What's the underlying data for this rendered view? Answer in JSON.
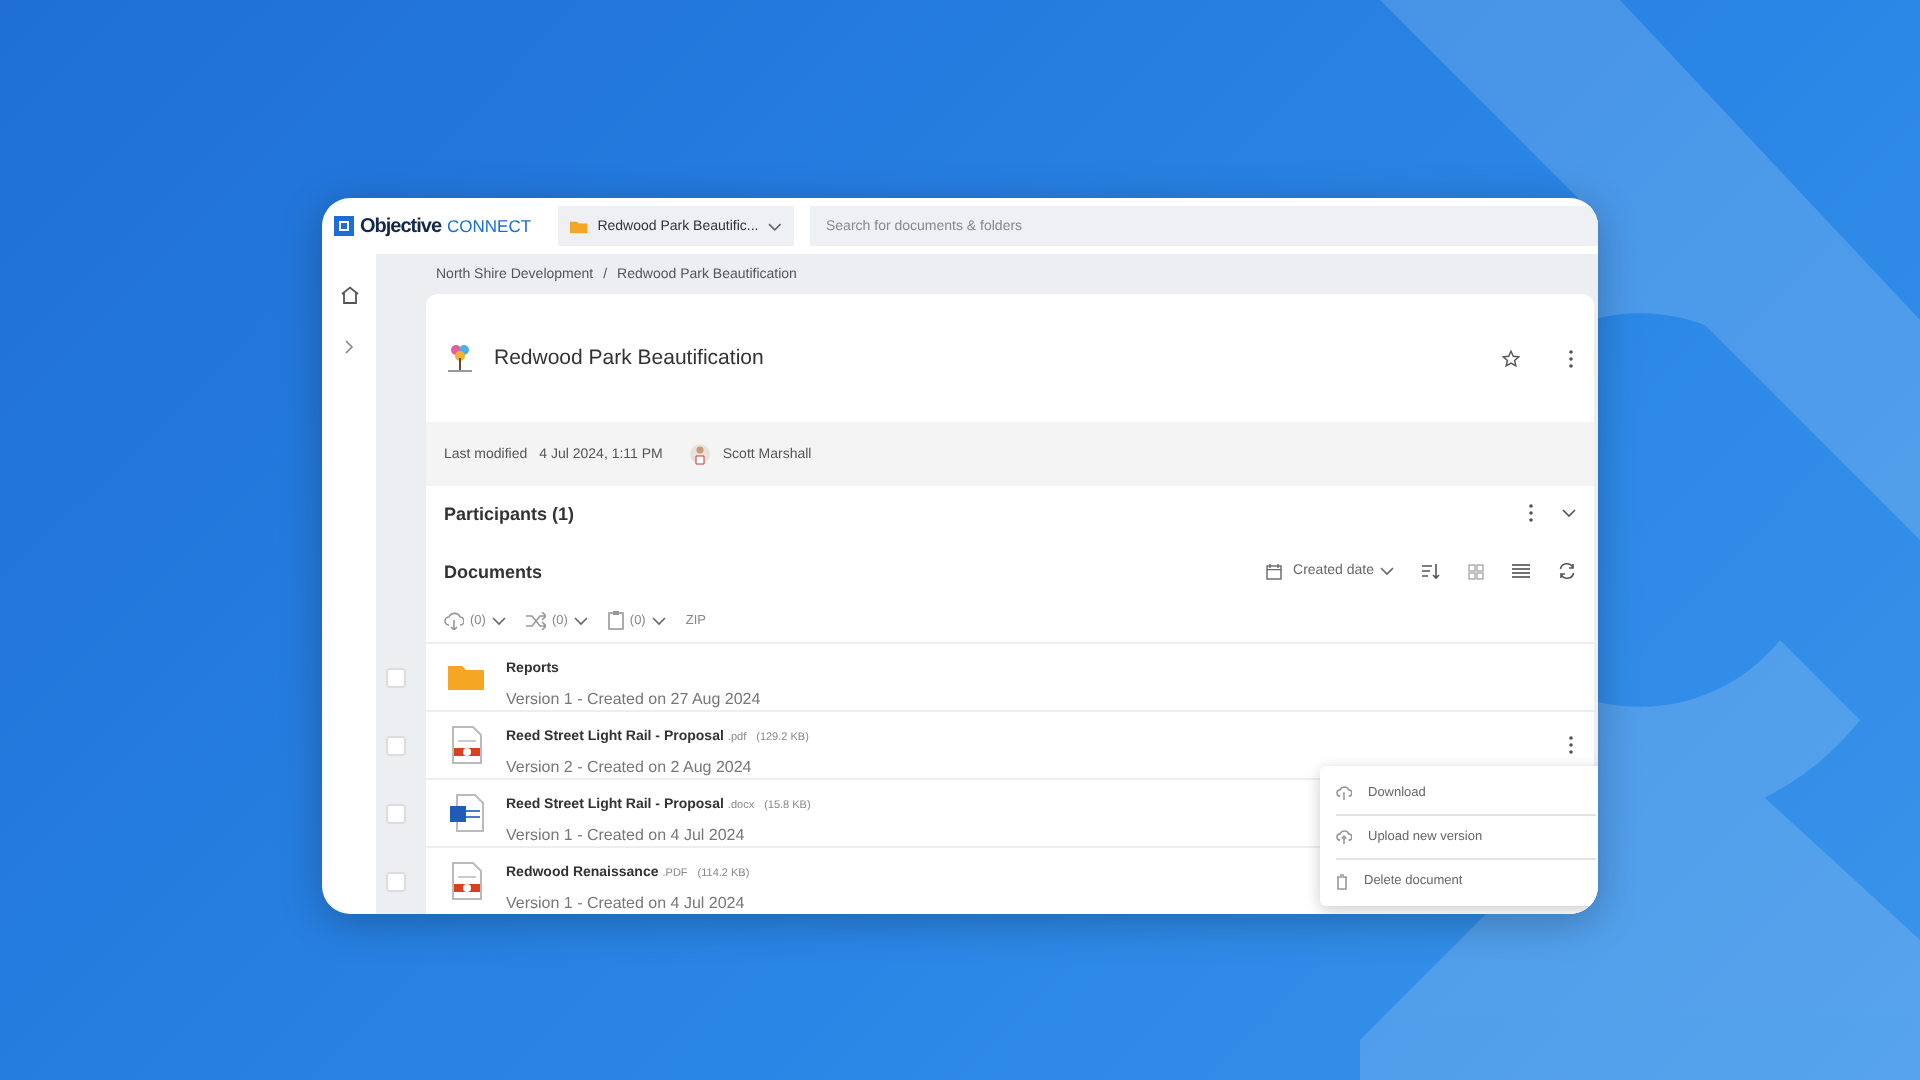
{
  "header": {
    "logo_bold": "Objective",
    "logo_light": "CONNECT",
    "project": "Redwood Park Beautific...",
    "search": {
      "placeholder": "Search for documents & folders"
    }
  },
  "breadcrumb": {
    "separator": "/",
    "items": [
      "North Shire Development",
      "Redwood Park Beautification"
    ]
  },
  "workspace": {
    "title": "Redwood Park Beautification",
    "starred": false,
    "last_modified_label": "Last modified",
    "last_modified": "4 Jul 2024, 1:11 PM",
    "user": "Scott Marshall"
  },
  "participants": {
    "title": "Participants (1)",
    "expanded": false
  },
  "documents": {
    "title": "Documents",
    "sort": "Created date",
    "toolbar": [
      {
        "kind": "download",
        "count": "(0)"
      },
      {
        "kind": "share",
        "count": "(0)"
      },
      {
        "kind": "clipboard",
        "count": "(0)"
      }
    ],
    "zip": "ZIP",
    "rows": [
      {
        "kind": "folder",
        "name": "Reports",
        "meta": "Version 1 - Created on 27 Aug 2024",
        "checked": false
      },
      {
        "kind": "pdf",
        "name": "Reed Street Light Rail - Proposal",
        "ext": ".pdf",
        "size": "(129.2 KB)",
        "meta": "Version 2 - Created on 2 Aug 2024",
        "checked": false,
        "menu": true
      },
      {
        "kind": "word",
        "name": "Reed Street Light Rail - Proposal",
        "ext": ".docx",
        "size": "(15.8 KB)",
        "meta": "Version 1 - Created on 4 Jul 2024",
        "checked": false
      },
      {
        "kind": "pdf",
        "name": "Redwood Renaissance",
        "ext": ".PDF",
        "size": "(114.2 KB)",
        "meta": "Version 1 - Created on 4 Jul 2024",
        "checked": false
      }
    ]
  },
  "context_menu": [
    {
      "kind": "download",
      "label": "Download"
    },
    {
      "kind": "upload",
      "label": "Upload new version"
    },
    {
      "kind": "delete",
      "label": "Delete document"
    }
  ]
}
